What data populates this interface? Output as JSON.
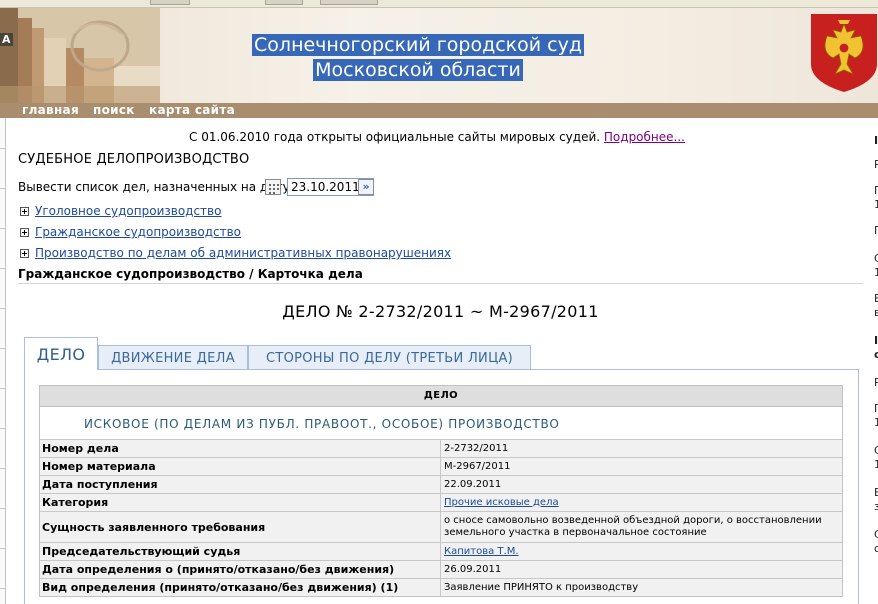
{
  "header": {
    "title_line1": "Солнечногорский городской суд",
    "title_line2": "Московской области",
    "edge_letter": "А",
    "nav": [
      {
        "label": "главная"
      },
      {
        "label": "поиск"
      },
      {
        "label": "карта сайта"
      }
    ]
  },
  "notice": {
    "text": "С 01.06.2010 года открыты официальные сайты мировых судей.",
    "link": "Подробнее..."
  },
  "section_title": "СУДЕБНОЕ ДЕЛОПРОИЗВОДСТВО",
  "date_filter": {
    "label": "Вывести список дел, назначенных на дату",
    "value": "23.10.2011",
    "go_symbol": "»"
  },
  "tree": [
    {
      "label": "Уголовное судопроизводство"
    },
    {
      "label": "Гражданское судопроизводство"
    },
    {
      "label": "Производство по делам об административных правонарушениях"
    }
  ],
  "breadcrumb": "Гражданское судопроизводство / Карточка дела",
  "case_title": "ДЕЛО № 2-2732/2011 ~ М-2967/2011",
  "tabs": [
    {
      "label": "ДЕЛО",
      "active": true
    },
    {
      "label": "ДВИЖЕНИЕ ДЕЛА",
      "active": false
    },
    {
      "label": "СТОРОНЫ ПО ДЕЛУ (ТРЕТЬИ ЛИЦА)",
      "active": false
    }
  ],
  "card": {
    "header": "ДЕЛО",
    "subheader": "ИСКОВОЕ (ПО ДЕЛАМ ИЗ ПУБЛ. ПРАВООТ., ОСОБОЕ) ПРОИЗВОДСТВО",
    "rows": [
      {
        "key": "Номер дела",
        "value": "2-2732/2011"
      },
      {
        "key": "Номер материала",
        "value": "М-2967/2011"
      },
      {
        "key": "Дата поступления",
        "value": "22.09.2011"
      },
      {
        "key": "Категория",
        "value": "Прочие исковые дела"
      },
      {
        "key": "Сущность заявленного требования",
        "value": "о сносе самовольно возведенной объездной дороги, о восстановлении земельного участка в первоначальное состояние"
      },
      {
        "key": "Председательствующий судья",
        "value": "Капитова Т.М."
      },
      {
        "key": "Дата определения о (принято/отказано/без движения)",
        "value": "26.09.2011"
      },
      {
        "key": "Вид определения (принято/отказано/без движения) (1)",
        "value": "Заявление ПРИНЯТО к производству"
      }
    ]
  },
  "right_fragments": [
    "I",
    "Р",
    "П",
    "1",
    "П",
    "С",
    "1",
    "Е",
    "в",
    "I",
    "с",
    "Р",
    "П",
    "1",
    "С",
    "1",
    "Е",
    "з",
    "С",
    "с"
  ],
  "colors": {
    "nav_bar": "#a88d6f",
    "title_highlight": "#3768b8",
    "link": "#1d4a9c",
    "visited_link": "#800080",
    "tab_border": "#aac0d8"
  },
  "icons": {
    "calendar": "calendar-icon",
    "go": "arrow-right-icon",
    "expand": "plus-square-icon",
    "emblem": "russian-coat-of-arms-icon"
  }
}
